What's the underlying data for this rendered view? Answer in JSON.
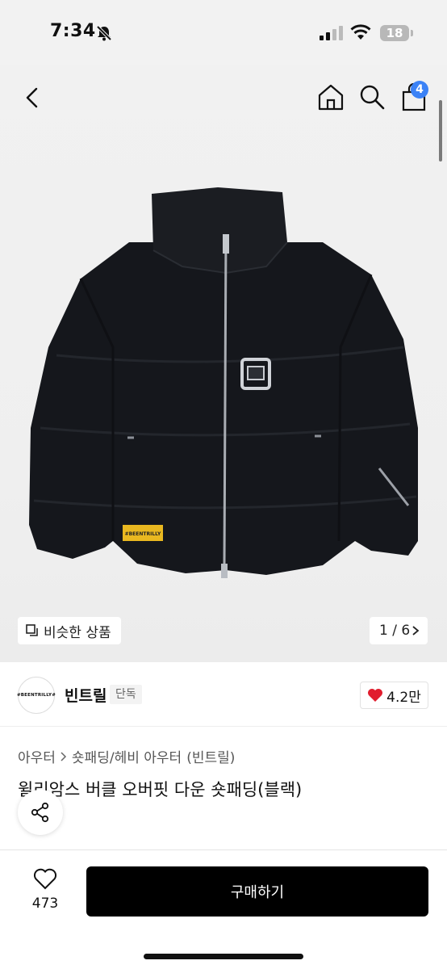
{
  "status_bar": {
    "time": "7:34",
    "battery": "18"
  },
  "header": {
    "cart_count": "4"
  },
  "gallery": {
    "similar_label": "비슷한 상품",
    "pager": "1 / 6",
    "jacket_label": "#BEENTRILLY"
  },
  "brand": {
    "logo_text": "#BEENTRILLY#",
    "name": "빈트릴",
    "tag": "단독",
    "likes": "4.2만"
  },
  "product": {
    "breadcrumb": [
      "아우터",
      "숏패딩/헤비 아우터",
      "(빈트릴)"
    ],
    "title": "윌리암스 버클 오버핏 다운 숏패딩(블랙)"
  },
  "bottom": {
    "wish_count": "473",
    "buy_label": "구매하기"
  },
  "colors": {
    "badge": "#3b82f6",
    "heart": "#e11d2e",
    "buy_bg": "#000000"
  }
}
